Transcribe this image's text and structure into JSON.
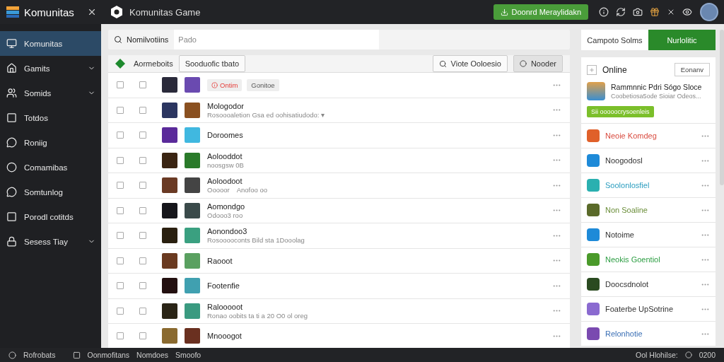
{
  "topbar": {
    "app_title": "Komunitas",
    "page_title": "Komunitas Game",
    "download_button": "Doonrd Meraylidakn"
  },
  "sidebar": {
    "items": [
      {
        "label": "Komunitas",
        "selected": true,
        "expandable": false
      },
      {
        "label": "Gamits",
        "selected": false,
        "expandable": true
      },
      {
        "label": "Somids",
        "selected": false,
        "expandable": true
      },
      {
        "label": "Totdos",
        "selected": false,
        "expandable": false
      },
      {
        "label": "Roniig",
        "selected": false,
        "expandable": false
      },
      {
        "label": "Comamibas",
        "selected": false,
        "expandable": false
      },
      {
        "label": "Somtunlog",
        "selected": false,
        "expandable": false
      },
      {
        "label": "Porodl cotitds",
        "selected": false,
        "expandable": false
      },
      {
        "label": "Sesess Tiay",
        "selected": false,
        "expandable": true
      }
    ]
  },
  "search": {
    "label": "Nomilvotiins",
    "placeholder": "Pado"
  },
  "list_toolbar": {
    "title": "Aormeboits",
    "filter_button": "Sooduofic tbato",
    "view_button": "Viote Ooloesio",
    "new_button": "Nooder"
  },
  "rows": [
    {
      "kind": "tags",
      "selected": false,
      "checked": false,
      "tags": [
        {
          "text": "Ontim",
          "kind": "alert"
        },
        {
          "text": "Gonitoe",
          "kind": "plain"
        }
      ]
    },
    {
      "kind": "item",
      "selected": false,
      "checked": false,
      "title": "Mologodor",
      "subtitle": "Rosoooaletion Gsa ed oohisatiudodo: ▾"
    },
    {
      "kind": "item",
      "selected": false,
      "checked": false,
      "title": "Doroomes"
    },
    {
      "kind": "item",
      "selected": false,
      "checked": false,
      "title": "Aolooddot",
      "subtitle": "noosgsw 0B"
    },
    {
      "kind": "item",
      "selected": false,
      "checked": false,
      "title": "Aoloodoot",
      "subtitle": "Ooooor",
      "note": "Anofoo oo"
    },
    {
      "kind": "item",
      "selected": false,
      "checked": false,
      "title": "Aomondgo",
      "subtitle": "Odooo3 roo"
    },
    {
      "kind": "item",
      "selected": false,
      "checked": false,
      "title": "Aonondoo3",
      "subtitle": "Rosooooconts Bild sta 1Dooolag"
    },
    {
      "kind": "item",
      "selected": false,
      "checked": false,
      "title": "Raooot"
    },
    {
      "kind": "item",
      "selected": false,
      "checked": false,
      "title": "Footenfie"
    },
    {
      "kind": "item",
      "selected": false,
      "checked": false,
      "title": "Ralooooot",
      "subtitle": "Ronao oobits ta ti a 20 O0 ol oreg"
    },
    {
      "kind": "item",
      "selected": false,
      "checked": false,
      "title": "Mnooogot"
    }
  ],
  "right_panel": {
    "tabs": [
      {
        "label": "Campoto Solms",
        "selected": false
      },
      {
        "label": "Nurlolitic",
        "selected": true
      }
    ],
    "online_card": {
      "label": "Online",
      "button": "Eonanv",
      "title": "Rammnnic Pdri Sógo Sloce",
      "subtitle": "Coobetiosa5ode Sioiar Odeos...",
      "action": "Sii ooooocrysoenleis"
    },
    "items": [
      {
        "label": "Neoie Komdeg",
        "color": "#d94b3f"
      },
      {
        "label": "Noogodosl",
        "color": "#333333"
      },
      {
        "label": "Soolonlosfiel",
        "color": "#2a9dbf"
      },
      {
        "label": "Non Soaline",
        "color": "#6b8e3a"
      },
      {
        "label": "Notoime",
        "color": "#333333"
      },
      {
        "label": "Neokis Goentiol",
        "color": "#2e9e44"
      },
      {
        "label": "Doocsdnolot",
        "color": "#333333"
      },
      {
        "label": "Foaterbe UpSotrine",
        "color": "#333333"
      },
      {
        "label": "Relonhotie",
        "color": "#3a6fb5"
      }
    ]
  },
  "status_bar": {
    "left": [
      "Rofrobats",
      "Oonmofitans",
      "Nomdoes",
      "Smoofo"
    ],
    "right_label": "Ool Hlohilse:",
    "right_value": "0200"
  }
}
